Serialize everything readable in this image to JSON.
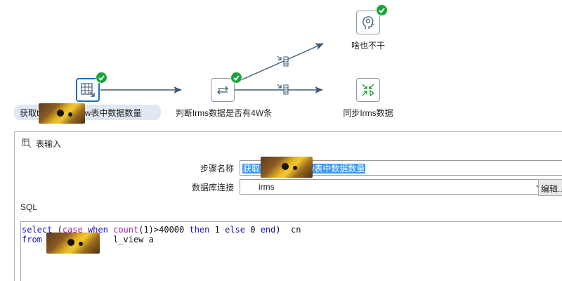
{
  "flow": {
    "nodes": [
      {
        "id": "table-input",
        "label_prefix": "获取t",
        "label_suffix": "view表中数据数量",
        "icon": "table-input-icon",
        "status": "success",
        "selected": true
      },
      {
        "id": "filter",
        "label": "判断Irms数据是否有4W条",
        "icon": "switch-arrows-icon",
        "status": "success"
      },
      {
        "id": "dummy",
        "label": "啥也不干",
        "icon": "head-gear-icon",
        "status": "success"
      },
      {
        "id": "sync",
        "label": "同步Irms数据",
        "icon": "sync-arrows-icon",
        "status": "none"
      }
    ],
    "hops": [
      {
        "from": "table-input",
        "to": "filter",
        "type": "normal"
      },
      {
        "from": "filter",
        "to": "dummy",
        "type": "conditional"
      },
      {
        "from": "filter",
        "to": "sync",
        "type": "conditional"
      }
    ],
    "colors": {
      "hop_line": "#3e5a73",
      "success": "#1aa33a",
      "selected_border": "#1f6fb5"
    }
  },
  "dialog": {
    "title": "表输入",
    "step_name_label": "步骤名称",
    "step_name_value_prefix": "获取t",
    "step_name_value_suffix": "view表中数据数量",
    "db_connection_label": "数据库连接",
    "db_connection_value": "irms",
    "edit_button_label": "编辑...",
    "sql_label": "SQL",
    "sql_line1": [
      {
        "t": "select",
        "c": "kw"
      },
      {
        "t": " (",
        "c": "tx"
      },
      {
        "t": "case",
        "c": "fn"
      },
      {
        "t": " ",
        "c": "tx"
      },
      {
        "t": "when",
        "c": "kw"
      },
      {
        "t": " ",
        "c": "tx"
      },
      {
        "t": "count",
        "c": "fn"
      },
      {
        "t": "(1)>40000 ",
        "c": "tx"
      },
      {
        "t": "then",
        "c": "kw"
      },
      {
        "t": " 1 ",
        "c": "tx"
      },
      {
        "t": "else",
        "c": "kw"
      },
      {
        "t": " 0 ",
        "c": "tx"
      },
      {
        "t": "end",
        "c": "kw"
      },
      {
        "t": ")  cn",
        "c": "tx"
      }
    ],
    "sql_line2": [
      {
        "t": "from",
        "c": "kw"
      },
      {
        "t": " t",
        "c": "tx"
      },
      {
        "t": "            ",
        "c": "tx"
      },
      {
        "t": "l_view a",
        "c": "tx"
      }
    ]
  }
}
